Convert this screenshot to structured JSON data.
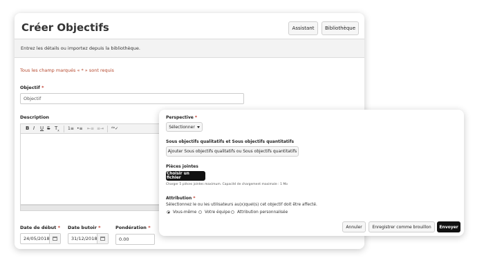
{
  "main": {
    "title": "Créer Objectifs",
    "buttons": {
      "assistant": "Assistant",
      "library": "Bibliothèque"
    },
    "info": "Entrez les détails ou importez depuis la bibliothèque.",
    "required_note": "Tous les champ marqués « * » sont requis",
    "objective": {
      "label": "Objectif",
      "required": "*",
      "placeholder": "Objectif"
    },
    "description": {
      "label": "Description"
    },
    "toolbar_icons": [
      "bold-icon",
      "italic-icon",
      "underline-icon",
      "strikethrough-icon",
      "clear-format-icon",
      "ordered-list-icon",
      "bullet-list-icon",
      "outdent-icon",
      "indent-icon",
      "spellcheck-icon"
    ],
    "start_date": {
      "label": "Date de début",
      "required": "*",
      "value": "24/05/2018"
    },
    "due_date": {
      "label": "Date butoir",
      "required": "*",
      "value": "31/12/2018"
    },
    "weight": {
      "label": "Pondération",
      "required": "*",
      "value": "0.00"
    }
  },
  "overlay": {
    "perspective": {
      "label": "Perspective",
      "required": "*",
      "select": "Sélectionner"
    },
    "sub_objectives": {
      "label": "Sous objectifs qualitatifs et Sous objectifs quantitatifs",
      "button": "Ajouter Sous objectifs qualitatifs ou Sous objectifs quantitatifs"
    },
    "attachments": {
      "label": "Pièces jointes",
      "button": "Choisir un fichier",
      "note": "Charger 5 pièces jointes maximum. Capacité de chargement maximale : 1 Mo"
    },
    "attribution": {
      "label": "Attribution",
      "required": "*",
      "help": "Sélectionnez le ou les utilisateurs au(x)quel(s) cet objectif doit être affecté.",
      "options": [
        "Vous-même",
        "Votre équipe",
        "Attribution personnalisée"
      ],
      "selected": "Vous-même"
    },
    "footer": {
      "cancel": "Annuler",
      "draft": "Enregistrer comme brouillon",
      "send": "Envoyer"
    }
  }
}
